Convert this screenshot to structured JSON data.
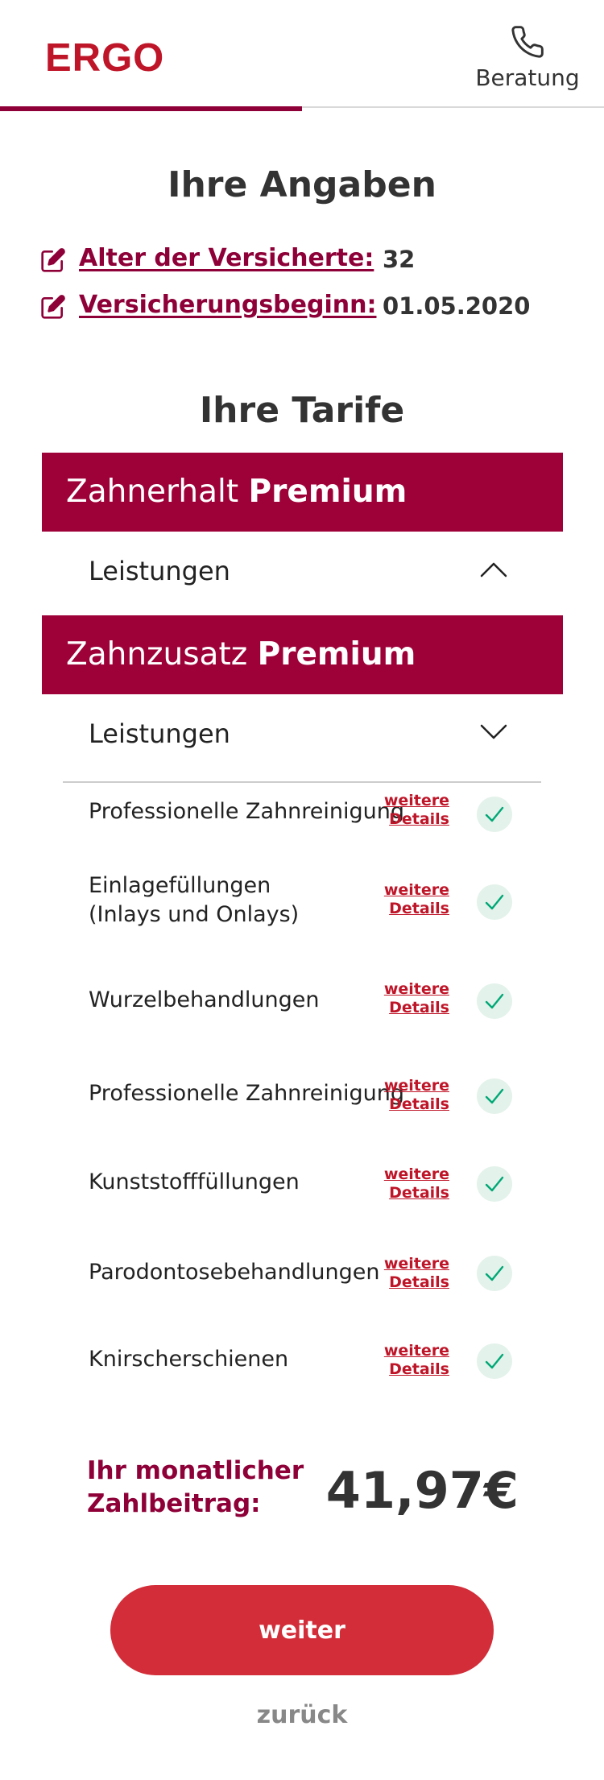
{
  "header": {
    "logo": "ERGO",
    "beratung_label": "Beratung"
  },
  "angaben": {
    "title": "Ihre Angaben",
    "rows": [
      {
        "label": "Alter der Versicherte:",
        "value": "32"
      },
      {
        "label": "Versicherungsbeginn:",
        "value": "01.05.2020"
      }
    ]
  },
  "tarife": {
    "title": "Ihre Tarife",
    "items": [
      {
        "name_regular": "Zahnerhalt",
        "name_bold": "Premium",
        "leistungen_label": "Leistungen",
        "expanded": false
      },
      {
        "name_regular": "Zahnzusatz",
        "name_bold": "Premium",
        "leistungen_label": "Leistungen",
        "expanded": true
      }
    ]
  },
  "leistungen": {
    "details_line1": "weitere",
    "details_line2": "Details",
    "items": [
      {
        "label": "Professionelle Zahnreinigung",
        "included": true
      },
      {
        "label": "Einlagefüllungen",
        "label2": "(Inlays und Onlays)",
        "included": true
      },
      {
        "label": "Wurzelbehandlungen",
        "included": true
      },
      {
        "label": "Professionelle Zahnreinigung",
        "included": true
      },
      {
        "label": "Kunststofffüllungen",
        "included": true
      },
      {
        "label": "Parodontosebehandlungen",
        "included": true
      },
      {
        "label": "Knirscherschienen",
        "included": true
      }
    ]
  },
  "beitrag": {
    "label_line1": "Ihr monatlicher",
    "label_line2": "Zahlbeitrag:",
    "value": "41,97€"
  },
  "buttons": {
    "weiter": "weiter",
    "zurueck": "zurück"
  },
  "colors": {
    "brand_red": "#bf1528",
    "band": "#9e0038",
    "accent": "#8e0038",
    "button": "#d22d38",
    "check": "#00a876"
  }
}
